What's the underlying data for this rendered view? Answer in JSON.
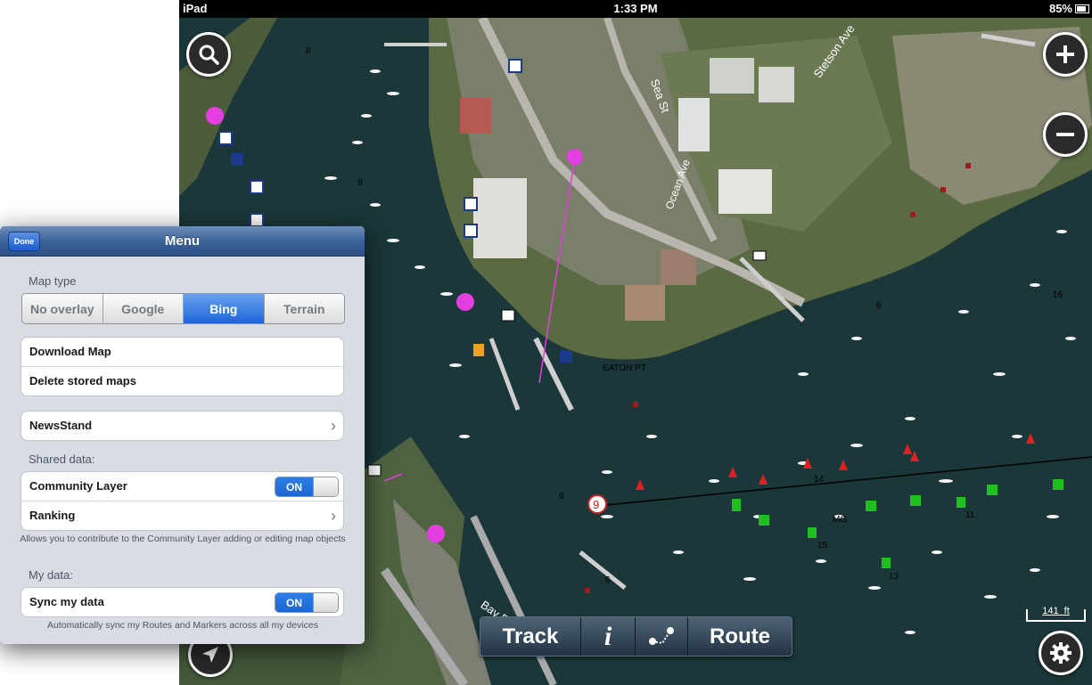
{
  "status_bar": {
    "carrier": "iPad",
    "time": "1:33 PM",
    "battery": "85%"
  },
  "map": {
    "labels": {
      "eaton_pt": "EATON PT",
      "mg": "MG",
      "scale": "141  ft",
      "route_waypoint": "9",
      "depth_1": "6",
      "depth_2": "9",
      "depth_3": "16",
      "depth_4": "6",
      "depth_5": "9",
      "depth_6": "6",
      "depth_7": "14",
      "depth_8": "15",
      "depth_9": "13",
      "depth_10": "11",
      "road_sea_st": "Sea St",
      "road_ocean_ave": "Ocean Ave",
      "road_stetson_ave": "Stetson Ave",
      "road_bay_rd": "Bay Rd"
    },
    "icons": {
      "search": "search-icon",
      "zoom_in": "plus-icon",
      "zoom_out": "minus-icon",
      "locate": "location-arrow-icon",
      "settings": "gear-icon"
    }
  },
  "toolbar": {
    "track": "Track",
    "info": "i",
    "route": "Route"
  },
  "menu": {
    "title": "Menu",
    "done": "Done",
    "map_type_label": "Map type",
    "map_types": [
      "No overlay",
      "Google",
      "Bing",
      "Terrain"
    ],
    "selected_map_type": "Bing",
    "download_map": "Download Map",
    "delete_maps": "Delete stored maps",
    "newsstand": "NewsStand",
    "shared_data_label": "Shared data:",
    "community_layer": "Community Layer",
    "community_toggle": "ON",
    "ranking": "Ranking",
    "community_note": "Allows you to contribute to the Community Layer adding or editing map objects",
    "my_data_label": "My data:",
    "sync": "Sync my data",
    "sync_toggle": "ON",
    "sync_note": "Automatically sync my Routes and Markers across all my devices"
  },
  "colors": {
    "water": "#1b3739",
    "nav_bar": "#2d5388",
    "selected_segment": "#1c64d8"
  }
}
